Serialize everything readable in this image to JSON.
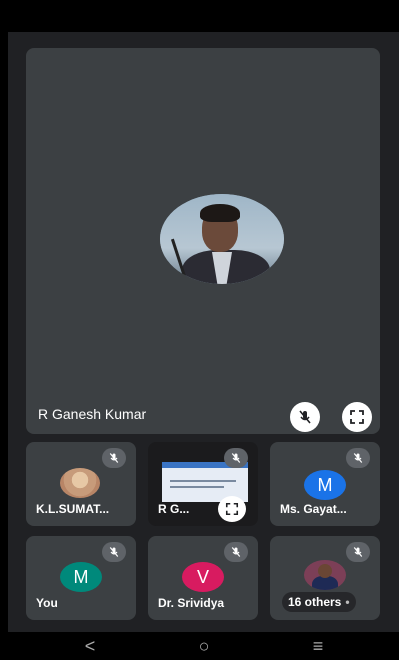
{
  "main": {
    "name": "R Ganesh Kumar"
  },
  "tiles": [
    {
      "label": "K.L.SUMAT...",
      "avatar": "photo"
    },
    {
      "label": "R G...",
      "avatar": "screen-share"
    },
    {
      "label": "Ms. Gayat...",
      "letter": "M",
      "letter_color": "#1a73e8"
    },
    {
      "label": "You",
      "letter": "M",
      "letter_color": "#00897b"
    },
    {
      "label": "Dr. Srividya",
      "letter": "V",
      "letter_color": "#d81b60"
    },
    {
      "label": "16 others",
      "avatar": "photo"
    }
  ],
  "nav": {
    "back": "<",
    "home": "○",
    "menu": "≡"
  }
}
